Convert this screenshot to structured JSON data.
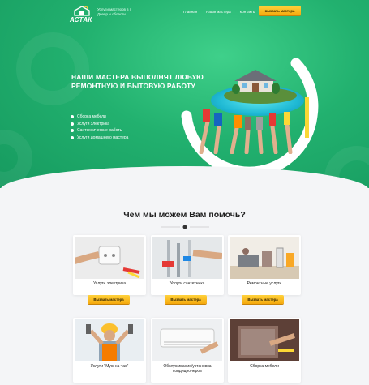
{
  "header": {
    "logo_text": "АСТАК",
    "tagline": "Услуги мастеров в г. Днепр и области",
    "nav": [
      "Главная",
      "Наши мастера",
      "Контакты"
    ],
    "call_button": "вызвать мастера"
  },
  "hero": {
    "title": "НАШИ МАСТЕРА ВЫПОЛНЯТ ЛЮБУЮ РЕМОНТНУЮ И БЫТОВУЮ РАБОТУ",
    "services": [
      "Сборка мебели",
      "Услуги электрика",
      "Сантехнические работы",
      "Услуги домашнего мастера"
    ]
  },
  "section": {
    "title": "Чем мы можем Вам помочь?"
  },
  "cards": [
    {
      "label": "Услуги электрика",
      "button": "Вызвать мастера",
      "icon": "electrician-photo"
    },
    {
      "label": "Услуги сантехника",
      "button": "Вызвать мастера",
      "icon": "plumber-photo"
    },
    {
      "label": "Ремонтные услуги",
      "button": "Вызвать мастера",
      "icon": "repair-photo"
    },
    {
      "label": "Услуги \"Муж на час\"",
      "button": "",
      "icon": "handyman-photo"
    },
    {
      "label": "Обслуживание/установка кондиционеров",
      "button": "",
      "icon": "ac-photo"
    },
    {
      "label": "Сборка мебели",
      "button": "",
      "icon": "furniture-photo"
    }
  ],
  "colors": {
    "hero_green": "#22b16f",
    "accent_yellow": "#f5a80c",
    "text_dark": "#1e1e1e"
  }
}
